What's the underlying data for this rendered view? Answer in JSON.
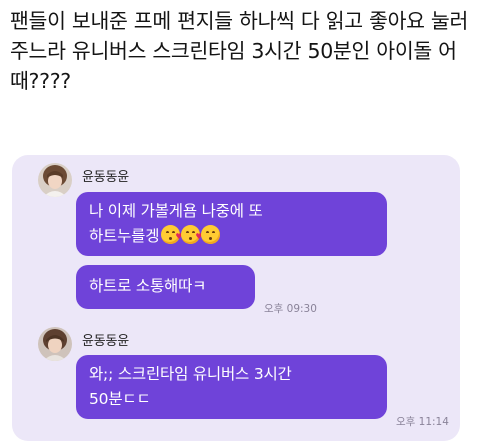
{
  "post": {
    "text": "팬들이 보내준 프메 편지들 하나씩 다 읽고 좋아요 눌러주느라 유니버스 스크린타임 3시간 50분인 아이돌 어때????"
  },
  "chat": {
    "background_color": "#ece7f8",
    "bubble_color": "#6f43d9",
    "messages_group_1": {
      "sender": "윤동동윤",
      "bubble_1_line_1": "나 이제 가볼게욤 나중에 또",
      "bubble_1_line_2": "하트누를겡",
      "bubble_1_emojis": [
        "face-blowing-kiss-icon",
        "face-blowing-kiss-icon",
        "kissing-smiling-eyes-icon"
      ],
      "bubble_2": "하트로 소통해따ㅋ",
      "time": "오후 09:30"
    },
    "messages_group_2": {
      "sender": "윤동동윤",
      "bubble_line_1": "와;; 스크린타임 유니버스 3시간",
      "bubble_line_2": "50분ㄷㄷ",
      "time": "오후 11:14"
    }
  }
}
